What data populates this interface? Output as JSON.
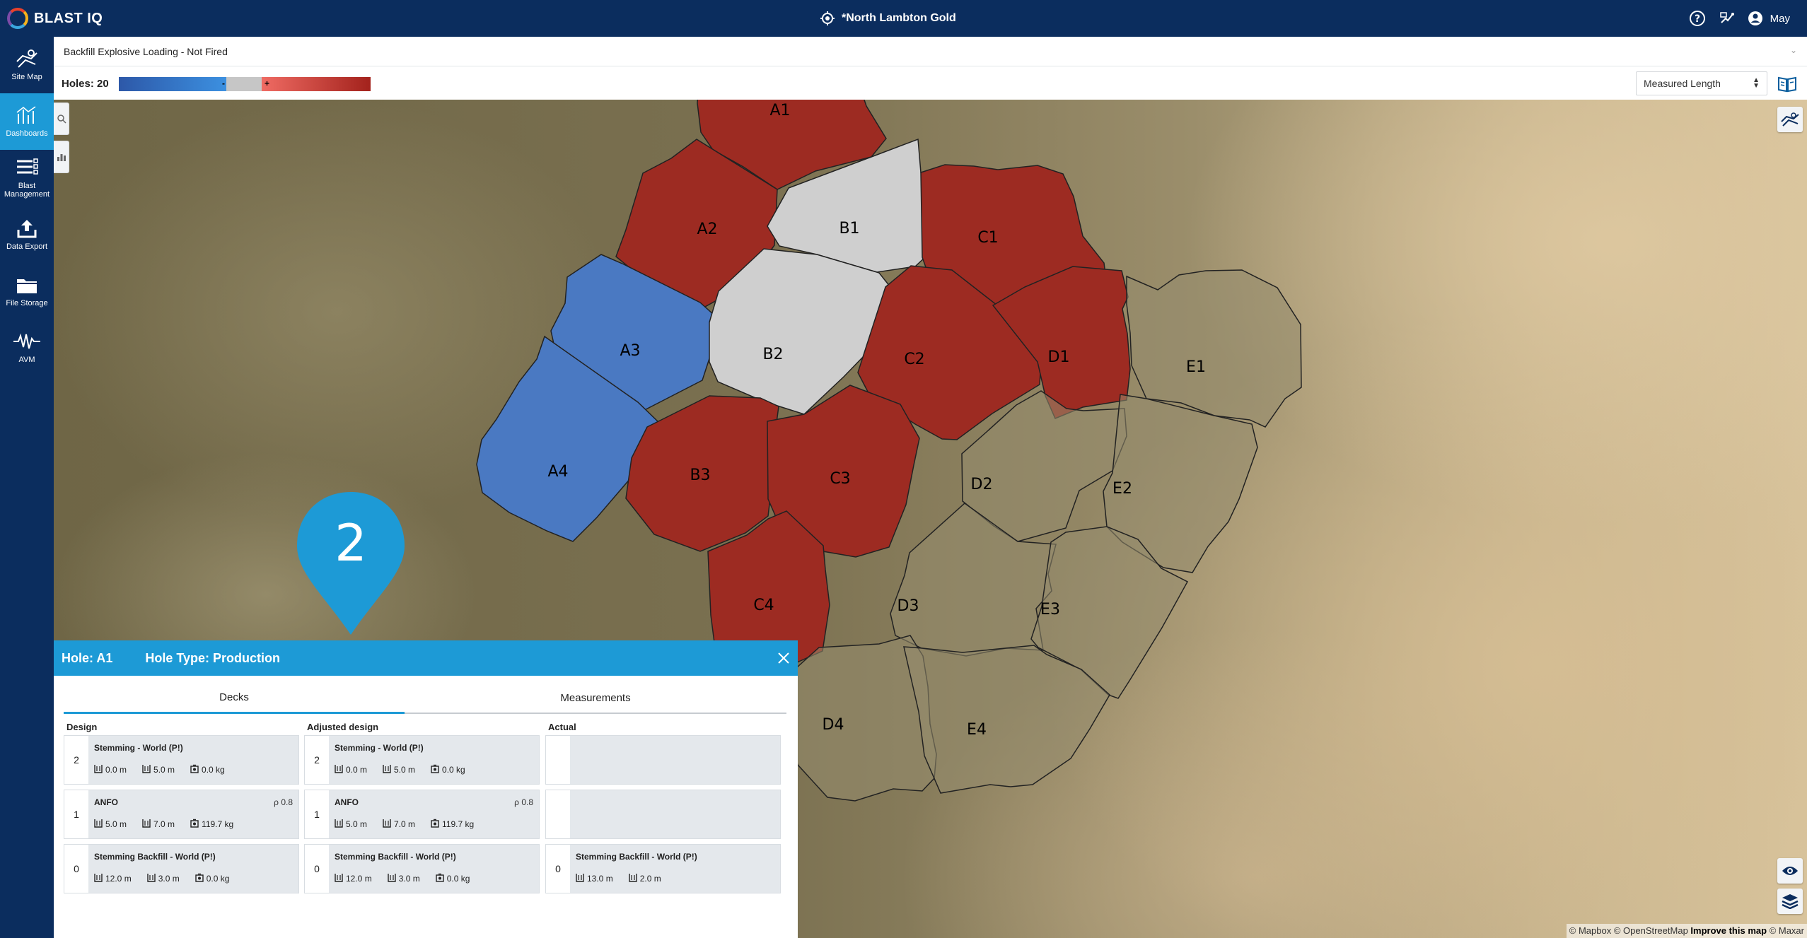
{
  "app": {
    "logo_text": "BLAST IQ",
    "site_title": "*North Lambton Gold",
    "user_name": "May"
  },
  "nav": {
    "items": [
      {
        "label": "Site Map",
        "icon": "map-icon"
      },
      {
        "label": "Dashboards",
        "icon": "dashboard-icon",
        "active": true
      },
      {
        "label": "Blast Management",
        "icon": "blast-management-icon"
      },
      {
        "label": "Data Export",
        "icon": "upload-icon"
      },
      {
        "label": "File Storage",
        "icon": "folder-icon"
      },
      {
        "label": "AVM",
        "icon": "waveform-icon"
      }
    ]
  },
  "dashboard": {
    "title": "Backfill Explosive Loading - Not Fired",
    "holes_label": "Holes: 20",
    "legend_negative": "-",
    "legend_positive": "+",
    "measure_select": "Measured Length",
    "colors": {
      "red": "#9d2b22",
      "blue": "#4a79c2",
      "grey": "#cfcfcf",
      "none": "rgba(150,140,110,0.55)"
    }
  },
  "map": {
    "cells": [
      {
        "label": "A1",
        "state": "red"
      },
      {
        "label": "A2",
        "state": "red"
      },
      {
        "label": "A3",
        "state": "blue"
      },
      {
        "label": "A4",
        "state": "blue"
      },
      {
        "label": "B1",
        "state": "grey"
      },
      {
        "label": "B2",
        "state": "grey"
      },
      {
        "label": "B3",
        "state": "red"
      },
      {
        "label": "C1",
        "state": "red"
      },
      {
        "label": "C2",
        "state": "red"
      },
      {
        "label": "C3",
        "state": "red"
      },
      {
        "label": "C4",
        "state": "red"
      },
      {
        "label": "D1",
        "state": "red"
      },
      {
        "label": "D2",
        "state": "none"
      },
      {
        "label": "D3",
        "state": "none"
      },
      {
        "label": "D4",
        "state": "none"
      },
      {
        "label": "E1",
        "state": "none"
      },
      {
        "label": "E2",
        "state": "none"
      },
      {
        "label": "E3",
        "state": "none"
      },
      {
        "label": "E4",
        "state": "none"
      }
    ],
    "pin_number": "2",
    "attribution": {
      "mapbox": "© Mapbox",
      "osm": "© OpenStreetMap",
      "improve": "Improve this map",
      "maxar": "© Maxar"
    }
  },
  "panel": {
    "hole": "Hole: A1",
    "hole_type": "Hole Type: Production",
    "tabs": [
      "Decks",
      "Measurements"
    ],
    "columns": [
      {
        "title": "Design",
        "decks": [
          {
            "num": "2",
            "name": "Stemming - World (P!)",
            "rho": "",
            "v1": "0.0 m",
            "v2": "5.0 m",
            "v3": "0.0 kg"
          },
          {
            "num": "1",
            "name": "ANFO",
            "rho": "ρ 0.8",
            "v1": "5.0 m",
            "v2": "7.0 m",
            "v3": "119.7 kg"
          },
          {
            "num": "0",
            "name": "Stemming Backfill - World (P!)",
            "rho": "",
            "v1": "12.0 m",
            "v2": "3.0 m",
            "v3": "0.0 kg"
          }
        ]
      },
      {
        "title": "Adjusted design",
        "decks": [
          {
            "num": "2",
            "name": "Stemming - World (P!)",
            "rho": "",
            "v1": "0.0 m",
            "v2": "5.0 m",
            "v3": "0.0 kg"
          },
          {
            "num": "1",
            "name": "ANFO",
            "rho": "ρ 0.8",
            "v1": "5.0 m",
            "v2": "7.0 m",
            "v3": "119.7 kg"
          },
          {
            "num": "0",
            "name": "Stemming Backfill - World (P!)",
            "rho": "",
            "v1": "12.0 m",
            "v2": "3.0 m",
            "v3": "0.0 kg"
          }
        ]
      },
      {
        "title": "Actual",
        "decks": [
          {
            "num": "",
            "name": "",
            "rho": "",
            "v1": "",
            "v2": "",
            "v3": ""
          },
          {
            "num": "",
            "name": "",
            "rho": "",
            "v1": "",
            "v2": "",
            "v3": ""
          },
          {
            "num": "0",
            "name": "Stemming Backfill - World (P!)",
            "rho": "",
            "v1": "13.0 m",
            "v2": "2.0 m",
            "v3": ""
          }
        ]
      }
    ]
  }
}
